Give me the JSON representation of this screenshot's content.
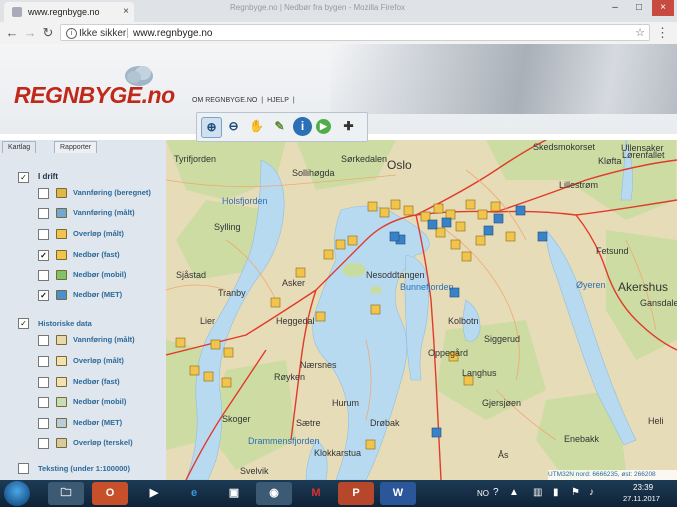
{
  "browser": {
    "tab_title": "www.regnbyge.no",
    "window_title": "Regnbyge.no | Nedbør fra bygen - Mozilla Firefox",
    "security_label": "Ikke sikker",
    "url": "www.regnbyge.no"
  },
  "header": {
    "logo_text": "REGNBYGE.no",
    "menu": [
      "OM REGNBYGE.NO",
      "|",
      "HJELP",
      "|"
    ]
  },
  "panel": {
    "tabs": [
      "Kartlag",
      "Rapporter"
    ],
    "in_operation": {
      "title": "I drift",
      "checked": true,
      "items": [
        {
          "label": "Vannføring (beregnet)",
          "checked": false,
          "color": "#e0b54a"
        },
        {
          "label": "Vannføring (målt)",
          "checked": false,
          "color": "#6fa7d6"
        },
        {
          "label": "Overløp (målt)",
          "checked": false,
          "color": "#f1c44d"
        },
        {
          "label": "Nedbør (fast)",
          "checked": true,
          "color": "#f1c44d"
        },
        {
          "label": "Nedbør (mobil)",
          "checked": false,
          "color": "#82c36a"
        },
        {
          "label": "Nedbør (MET)",
          "checked": true,
          "color": "#4a8fd3"
        }
      ]
    },
    "historic": {
      "title": "Historiske data",
      "checked": true,
      "items": [
        {
          "label": "Vannføring (målt)",
          "checked": false,
          "color": "#e8d9a8"
        },
        {
          "label": "Overløp (målt)",
          "checked": false,
          "color": "#f3e2b0"
        },
        {
          "label": "Nedbør (fast)",
          "checked": false,
          "color": "#f3e2b0"
        },
        {
          "label": "Nedbør (mobil)",
          "checked": false,
          "color": "#c6ddb6"
        },
        {
          "label": "Nedbør (MET)",
          "checked": false,
          "color": "#b6cde3"
        },
        {
          "label": "Overløp (terskel)",
          "checked": false,
          "color": "#d8c9a0"
        }
      ]
    },
    "footer_item": {
      "label": "Teksting (under 1:100000)",
      "checked": false
    }
  },
  "map": {
    "places": [
      {
        "name": "Oslo",
        "style": "big"
      },
      {
        "name": "Lillestrøm",
        "style": "normal"
      },
      {
        "name": "Kløfta",
        "style": "normal"
      },
      {
        "name": "Ullensaker",
        "style": "normal"
      },
      {
        "name": "Skedsmokorset",
        "style": "normal"
      },
      {
        "name": "Lørenfallet",
        "style": "normal"
      },
      {
        "name": "Fetsund",
        "style": "normal"
      },
      {
        "name": "Akershus",
        "style": "big"
      },
      {
        "name": "Sørkedalen",
        "style": "normal"
      },
      {
        "name": "Sollihøgda",
        "style": "normal"
      },
      {
        "name": "Holsfjorden",
        "style": "blue"
      },
      {
        "name": "Sylling",
        "style": "normal"
      },
      {
        "name": "Sjåstad",
        "style": "normal"
      },
      {
        "name": "Tranby",
        "style": "normal"
      },
      {
        "name": "Asker",
        "style": "normal"
      },
      {
        "name": "Heggedal",
        "style": "normal"
      },
      {
        "name": "Nesoddtangen",
        "style": "normal"
      },
      {
        "name": "Bunnefjorden",
        "style": "blue"
      },
      {
        "name": "Kolbotn",
        "style": "normal"
      },
      {
        "name": "Oppegård",
        "style": "normal"
      },
      {
        "name": "Langhus",
        "style": "normal"
      },
      {
        "name": "Siggerud",
        "style": "normal"
      },
      {
        "name": "Røyken",
        "style": "normal"
      },
      {
        "name": "Sætre",
        "style": "normal"
      },
      {
        "name": "Drøbak",
        "style": "normal"
      },
      {
        "name": "Skoger",
        "style": "normal"
      },
      {
        "name": "Drammensfjorden",
        "style": "blue"
      },
      {
        "name": "Svelvik",
        "style": "normal"
      },
      {
        "name": "Tyrifjorden",
        "style": "normal"
      },
      {
        "name": "Øyeren",
        "style": "blue"
      },
      {
        "name": "Gjersjøen",
        "style": "normal"
      },
      {
        "name": "Nærsnes",
        "style": "normal"
      },
      {
        "name": "Klokkarstua",
        "style": "normal"
      },
      {
        "name": "Hurum",
        "style": "normal"
      },
      {
        "name": "Ås",
        "style": "normal"
      },
      {
        "name": "Lier",
        "style": "normal"
      },
      {
        "name": "Heli",
        "style": "normal"
      },
      {
        "name": "Gansdalen",
        "style": "normal"
      },
      {
        "name": "Enebakk",
        "style": "normal"
      }
    ],
    "utm": "UTM32N nord: 6666235, øst: 266208",
    "toolbar": [
      "zoom-in",
      "zoom-out",
      "pan-hand",
      "measure",
      "info",
      "refresh",
      "move-down"
    ]
  },
  "tray": {
    "language": "NO",
    "time": "23:39",
    "date": "27.11.2017"
  },
  "colors": {
    "logo": "#c0281a",
    "panel_bg": "#dfe6ee",
    "map_land": "#e7dcb8",
    "water": "#b8daf0",
    "road": "#e23a2a",
    "marker_yellow": "#f1c44d",
    "marker_blue": "#3a82c8"
  }
}
